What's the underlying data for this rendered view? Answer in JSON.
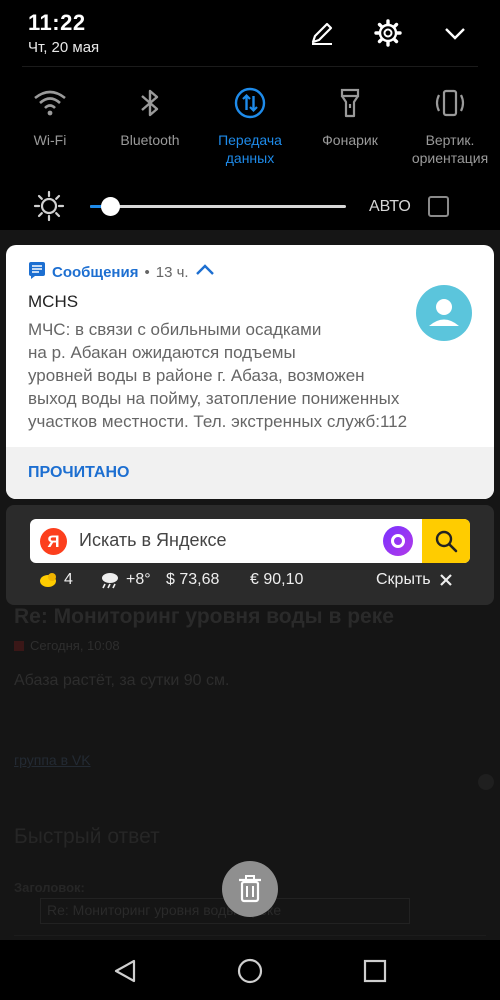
{
  "status": {
    "time": "11:22",
    "date": "Чт, 20 мая"
  },
  "quick_tiles": [
    {
      "label": "Wi-Fi",
      "icon": "wifi-icon",
      "active": false
    },
    {
      "label": "Bluetooth",
      "icon": "bluetooth-icon",
      "active": false
    },
    {
      "label": "Передача\nданных",
      "icon": "mobile-data-icon",
      "active": true
    },
    {
      "label": "Фонарик",
      "icon": "flashlight-icon",
      "active": false
    },
    {
      "label": "Вертик.\nориентация",
      "icon": "rotation-lock-icon",
      "active": false
    }
  ],
  "brightness": {
    "level": 0.08,
    "auto_label": "АВТО",
    "auto_checked": false
  },
  "notification": {
    "app_name": "Сообщения",
    "separator": "•",
    "time_ago": "13 ч.",
    "title": "MCHS",
    "body": "МЧС: в связи с обильными осадками\nна р. Абакан ожидаются подъемы\nуровней воды в районе г. Абаза, возможен\nвыход воды на пойму, затопление пониженных\nучастков местности. Тел. экстренных служб:112",
    "action": "ПРОЧИТАНО"
  },
  "yandex_widget": {
    "logo_letter": "Я",
    "search_placeholder": "Искать в Яндексе",
    "traffic_score": "4",
    "weather": "+8°",
    "usd": "$ 73,68",
    "eur": "€ 90,10",
    "hide_label": "Скрыть"
  },
  "background_page": {
    "title": "Re: Мониторинг уровня воды в реке",
    "meta": "Сегодня, 10:08",
    "text": "Абаза растёт, за сутки 90 см.",
    "link": "группа в VK",
    "reply_heading": "Быстрый ответ",
    "subject_label": "Заголовок:",
    "subject_value": "Re: Мониторинг уровня воды в реке"
  },
  "colors": {
    "accent": "#1e8bea",
    "link": "#1d6fd1",
    "yandex_red": "#fc3f1d",
    "yandex_yellow": "#ffcc00"
  }
}
